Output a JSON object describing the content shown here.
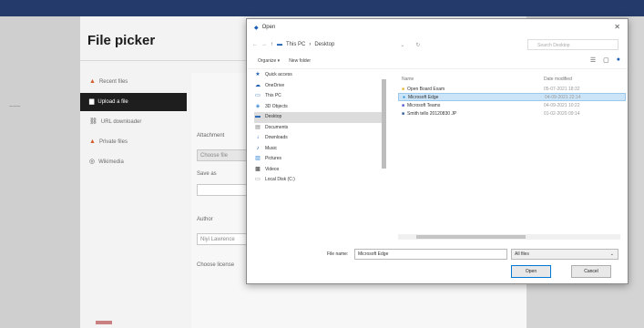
{
  "picker": {
    "title": "File picker",
    "nav": [
      {
        "label": "Recent files",
        "icon": "fox-icon"
      },
      {
        "label": "Upload a file",
        "icon": "upload-icon"
      },
      {
        "label": "URL downloader",
        "icon": "link-icon"
      },
      {
        "label": "Private files",
        "icon": "fox-icon"
      },
      {
        "label": "Wikimedia",
        "icon": "globe-icon"
      }
    ],
    "form": {
      "attachment_label": "Attachment",
      "choose_button": "Choose file",
      "save_as_label": "Save as",
      "author_label": "Author",
      "author_value": "Niyi Lawrence",
      "license_label": "Choose license"
    }
  },
  "dialog": {
    "title": "Open",
    "breadcrumb": [
      "This PC",
      "Desktop"
    ],
    "search_placeholder": "Search Desktop",
    "organize_label": "Organize ▾",
    "new_folder_label": "New folder",
    "tree": [
      {
        "label": "Quick access",
        "icon": "star-icon"
      },
      {
        "label": "OneDrive",
        "icon": "cloud-icon"
      },
      {
        "label": "This PC",
        "icon": "pc-icon"
      },
      {
        "label": "3D Objects",
        "icon": "cube-icon"
      },
      {
        "label": "Desktop",
        "icon": "desktop-icon"
      },
      {
        "label": "Documents",
        "icon": "documents-icon"
      },
      {
        "label": "Downloads",
        "icon": "download-icon"
      },
      {
        "label": "Music",
        "icon": "music-icon"
      },
      {
        "label": "Pictures",
        "icon": "pictures-icon"
      },
      {
        "label": "Videos",
        "icon": "videos-icon"
      },
      {
        "label": "Local Disk (C:)",
        "icon": "disk-icon"
      }
    ],
    "columns": {
      "name": "Name",
      "date": "Date modified"
    },
    "files": [
      {
        "name": "Open Board Exam",
        "date": "05-07-2021 18:32",
        "icon": "folder-icon"
      },
      {
        "name": "Microsoft Edge",
        "date": "04-09-2021 22:14",
        "icon": "edge-icon"
      },
      {
        "name": "Microsoft Teams",
        "date": "04-09-2021 10:22",
        "icon": "teams-icon"
      },
      {
        "name": "Smith tello 20120830 JP",
        "date": "01-02-2020 09:14",
        "icon": "file-icon"
      }
    ],
    "filename_label": "File name:",
    "filename_value": "Microsoft Edge",
    "filetype_value": "All files",
    "open_button": "Open",
    "cancel_button": "Cancel"
  }
}
